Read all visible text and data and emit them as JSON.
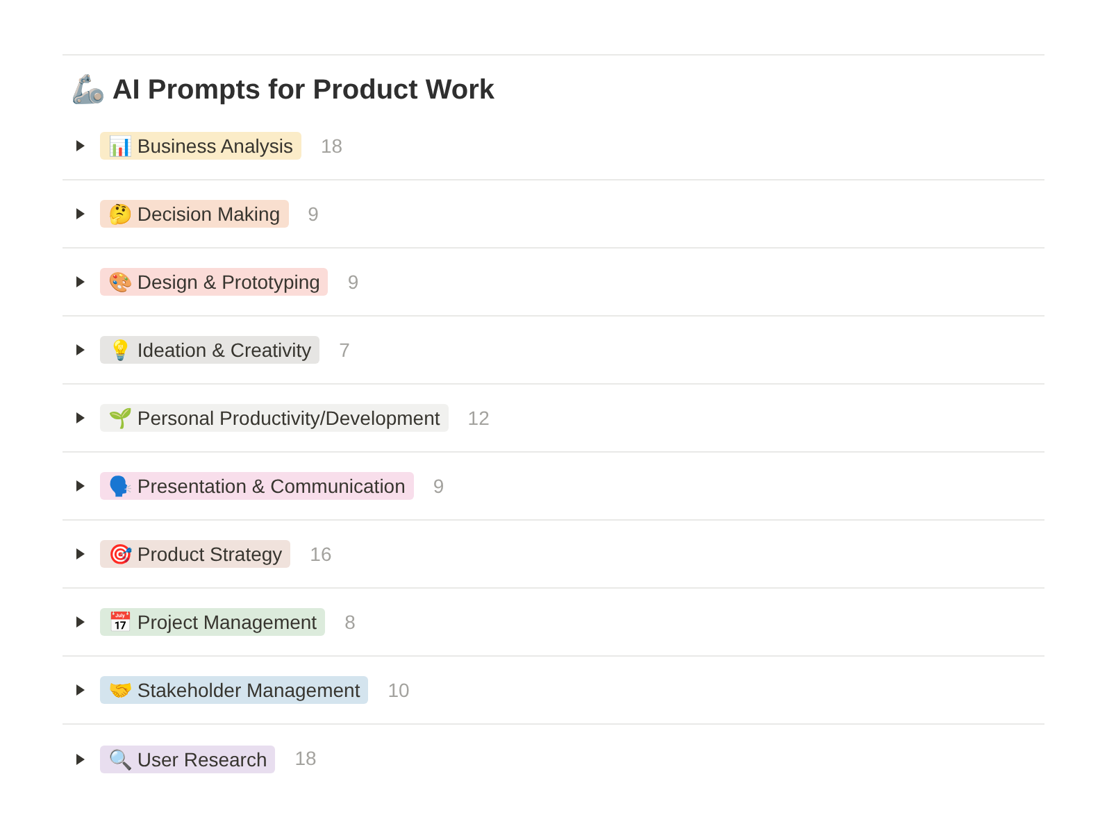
{
  "title": "🦾 AI Prompts for Product Work",
  "groups": [
    {
      "label": "📊 Business Analysis",
      "count": "18",
      "color": "#fbecc8",
      "expanded": false
    },
    {
      "label": "🤔 Decision Making",
      "count": "9",
      "color": "#f9dfcf",
      "expanded": false
    },
    {
      "label": "🎨 Design & Prototyping",
      "count": "9",
      "color": "#fbdcd8",
      "expanded": false
    },
    {
      "label": "💡 Ideation & Creativity",
      "count": "7",
      "color": "#e6e5e3",
      "expanded": false
    },
    {
      "label": "🌱 Personal Productivity/Development",
      "count": "12",
      "color": "#f1f1ef",
      "expanded": false
    },
    {
      "label": "🗣️ Presentation & Communication",
      "count": "9",
      "color": "#f8deeb",
      "expanded": false
    },
    {
      "label": "🎯 Product Strategy",
      "count": "16",
      "color": "#f0e2dc",
      "expanded": false
    },
    {
      "label": "📅 Project Management",
      "count": "8",
      "color": "#dcebdc",
      "expanded": false
    },
    {
      "label": "🤝 Stakeholder Management",
      "count": "10",
      "color": "#d4e4ee",
      "expanded": false
    },
    {
      "label": "🔍 User Research",
      "count": "18",
      "color": "#e8deef",
      "expanded": false
    }
  ]
}
